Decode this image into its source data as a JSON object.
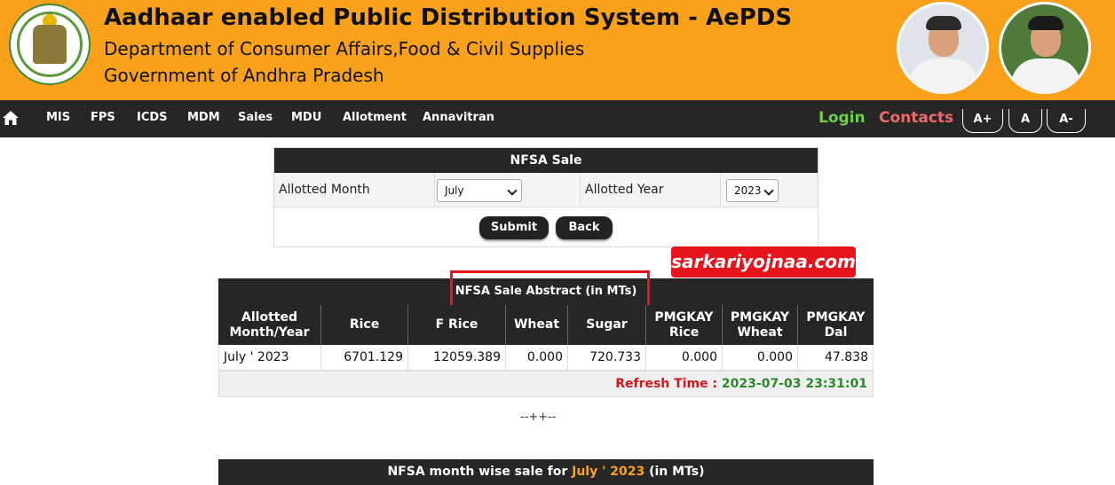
{
  "header": {
    "title": "Aadhaar enabled Public Distribution System - AePDS",
    "subtitle1": "Department of Consumer Affairs,Food & Civil Supplies",
    "subtitle2": "Government of Andhra Pradesh",
    "brand_color": "#f9a11b"
  },
  "nav": {
    "home_icon": "home-icon",
    "items": [
      "MIS",
      "FPS",
      "ICDS",
      "MDM",
      "Sales",
      "MDU",
      "Allotment",
      "Annavitran"
    ],
    "login": "Login",
    "contacts": "Contacts",
    "font_controls": [
      "A+",
      "A",
      "A-"
    ]
  },
  "form": {
    "title": "NFSA Sale",
    "month_label": "Allotted Month",
    "month_value": "July",
    "year_label": "Allotted Year",
    "year_value": "2023",
    "submit": "Submit",
    "back": "Back"
  },
  "watermark": "sarkariyojnaa.com",
  "abstract": {
    "title": "NFSA Sale Abstract (in MTs)",
    "headers": [
      "Allotted Month/Year",
      "Rice",
      "F Rice",
      "Wheat",
      "Sugar",
      "PMGKAY Rice",
      "PMGKAY Wheat",
      "PMGKAY Dal"
    ],
    "row": [
      "July ' 2023",
      "6701.129",
      "12059.389",
      "0.000",
      "720.733",
      "0.000",
      "0.000",
      "47.838"
    ],
    "refresh_label": "Refresh Time :",
    "refresh_time": "2023-07-03 23:31:01"
  },
  "separator": "--++--",
  "month_wise": {
    "prefix": "NFSA month wise sale for",
    "period": "July ' 2023",
    "suffix": "(in MTs)"
  }
}
